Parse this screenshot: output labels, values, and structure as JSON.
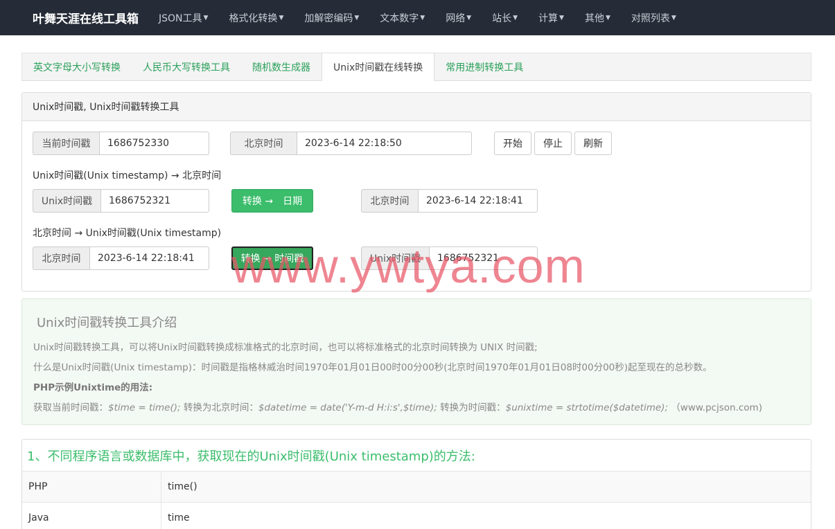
{
  "navbar": {
    "brand": "叶舞天涯在线工具箱",
    "items": [
      "JSON工具",
      "格式化转换",
      "加解密编码",
      "文本数字",
      "网络",
      "站长",
      "计算",
      "其他",
      "对照列表"
    ]
  },
  "tabs": [
    "英文字母大小写转换",
    "人民币大写转换工具",
    "随机数生成器",
    "Unix时间戳在线转换",
    "常用进制转换工具"
  ],
  "panel": {
    "title": "Unix时间戳, Unix时间戳转换工具",
    "current": {
      "ts_label": "当前时间戳",
      "ts_value": "1686752330",
      "bj_label": "北京时间",
      "bj_value": "2023-6-14 22:18:50",
      "start": "开始",
      "stop": "停止",
      "refresh": "刷新"
    },
    "to_date": {
      "heading": "Unix时间戳(Unix timestamp) → 北京时间",
      "in_label": "Unix时间戳",
      "in_value": "1686752321",
      "button": "转换 →　日期",
      "out_label": "北京时间",
      "out_value": "2023-6-14 22:18:41"
    },
    "to_ts": {
      "heading": "北京时间 → Unix时间戳(Unix timestamp)",
      "in_label": "北京时间",
      "in_value": "2023-6-14 22:18:41",
      "button": "转换 → 时间戳",
      "out_label": "Unix时间戳",
      "out_value": "1686752321"
    }
  },
  "intro": {
    "title": "Unix时间戳转换工具介绍",
    "line1": "Unix时间戳转换工具，可以将Unix时间戳转换成标准格式的北京时间，也可以将标准格式的北京时间转换为 UNIX 时间戳;",
    "line2": "什么是Unix时间戳(Unix timestamp)：时间戳是指格林威治时间1970年01月01日00时00分00秒(北京时间1970年01月01日08时00分00秒)起至现在的总秒数。",
    "line3": "PHP示例Unixtime的用法:",
    "l4_a": "获取当前时间戳：",
    "l4_b": "$time = time();",
    "l4_c": "转换为北京时间：",
    "l4_d": "$datetime = date('Y-m-d H:i:s',$time);",
    "l4_e": "转换为时间戳：",
    "l4_f": "$unixtime = strtotime($datetime);",
    "l4_g": "（www.pcjson.com)"
  },
  "methods": {
    "title": "1、不同程序语言或数据库中，获取现在的Unix时间戳(Unix timestamp)的方法:",
    "rows": [
      {
        "lang": "PHP",
        "code": "time()"
      },
      {
        "lang": "Java",
        "code": "time"
      }
    ]
  },
  "watermark": "www.ywtya.com"
}
